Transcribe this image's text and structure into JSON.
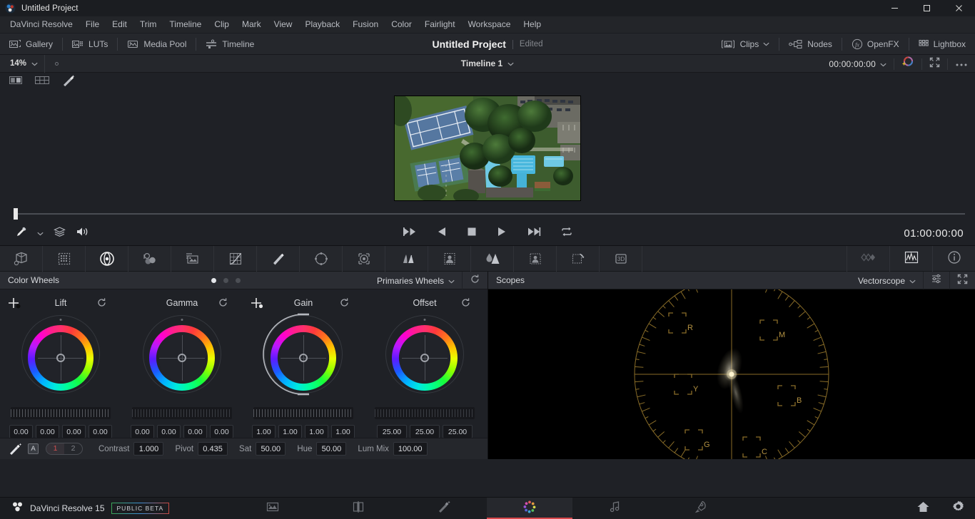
{
  "window": {
    "title": "Untitled Project",
    "logo_icon": "davinci-resolve-logo-icon",
    "minimize_icon": "minimize-icon",
    "maximize_icon": "maximize-icon",
    "close_icon": "close-icon"
  },
  "menubar": {
    "items": [
      "DaVinci Resolve",
      "File",
      "Edit",
      "Trim",
      "Timeline",
      "Clip",
      "Mark",
      "View",
      "Playback",
      "Fusion",
      "Color",
      "Fairlight",
      "Workspace",
      "Help"
    ]
  },
  "toolbar": {
    "left": [
      {
        "label": "Gallery",
        "icon": "gallery-icon"
      },
      {
        "label": "LUTs",
        "icon": "luts-icon"
      },
      {
        "label": "Media Pool",
        "icon": "media-pool-icon"
      },
      {
        "label": "Timeline",
        "icon": "timeline-icon"
      }
    ],
    "right": [
      {
        "label": "Clips",
        "icon": "clips-icon",
        "has_chevron": true
      },
      {
        "label": "Nodes",
        "icon": "nodes-icon",
        "has_chevron": false
      },
      {
        "label": "OpenFX",
        "icon": "openfx-icon",
        "has_chevron": false
      },
      {
        "label": "Lightbox",
        "icon": "lightbox-icon",
        "has_chevron": false
      }
    ],
    "project_name": "Untitled Project",
    "project_status": "Edited"
  },
  "viewer_header": {
    "zoom": "14%",
    "zoom_chevron_icon": "chevron-down-icon",
    "fit_dot_icon": "fit-dot-icon",
    "timeline_name": "Timeline 1",
    "timeline_chevron_icon": "chevron-down-icon",
    "timecode": "00:00:00:00",
    "timecode_chevron_icon": "chevron-down-icon",
    "color_wheel_icon": "enhanced-viewer-icon",
    "fullscreen_icon": "fullscreen-icon",
    "more_options_icon": "more-options-icon"
  },
  "viewer_modes": [
    {
      "icon": "split-screen-icon"
    },
    {
      "icon": "grid-view-icon"
    },
    {
      "icon": "magic-wand-icon"
    }
  ],
  "viewer": {
    "image_description": "aerial-drone-view-of-tennis-courts-and-swimming-pools"
  },
  "transport": {
    "eyedropper_icon": "eyedropper-icon",
    "eyedropper_chevron_icon": "chevron-down-icon",
    "layers_icon": "layers-icon",
    "audio_icon": "speaker-icon",
    "controls": [
      {
        "icon": "skip-to-start-icon"
      },
      {
        "icon": "play-reverse-icon"
      },
      {
        "icon": "stop-icon"
      },
      {
        "icon": "play-forward-icon"
      },
      {
        "icon": "skip-to-end-icon"
      },
      {
        "icon": "loop-icon"
      }
    ],
    "timecode": "01:00:00:00"
  },
  "palette_bar": {
    "icons": [
      "camera-raw-icon",
      "color-match-icon",
      "color-wheels-icon",
      "color-bars-icon",
      "log-wheels-icon",
      "curves-icon",
      "color-warper-icon",
      "qualifier-icon",
      "power-windows-icon",
      "tracker-icon",
      "magic-mask-icon",
      "blur-icon",
      "key-icon",
      "sizing-icon",
      "stabilizer-icon",
      "3d-icon"
    ],
    "active_index": 2,
    "right_icons": [
      "keyframes-icon",
      "scopes-icon",
      "info-icon"
    ]
  },
  "color_wheels_panel": {
    "title": "Color Wheels",
    "mode": "Primaries Wheels",
    "mode_chevron_icon": "chevron-down-icon",
    "reset_icon": "reset-icon",
    "page_dots": {
      "count": 3,
      "active": 0
    },
    "wheels": [
      {
        "name": "Lift",
        "reset_icon": "reset-icon",
        "values": [
          "0.00",
          "0.00",
          "0.00",
          "0.00"
        ],
        "master_arc": false,
        "has_cross_handle": true,
        "slider_dim": false
      },
      {
        "name": "Gamma",
        "reset_icon": "reset-icon",
        "values": [
          "0.00",
          "0.00",
          "0.00",
          "0.00"
        ],
        "master_arc": false,
        "has_cross_handle": false,
        "slider_dim": true
      },
      {
        "name": "Gain",
        "reset_icon": "reset-icon",
        "values": [
          "1.00",
          "1.00",
          "1.00",
          "1.00"
        ],
        "master_arc": true,
        "has_cross_handle": true,
        "slider_dim": false
      },
      {
        "name": "Offset",
        "reset_icon": "reset-icon",
        "values": [
          "25.00",
          "25.00",
          "25.00"
        ],
        "master_arc": false,
        "has_cross_handle": false,
        "slider_dim": true
      }
    ]
  },
  "param_bar": {
    "magic_icon": "auto-balance-icon",
    "a_badge": "A",
    "nodes": [
      "1",
      "2"
    ],
    "params": [
      {
        "label": "Contrast",
        "value": "1.000"
      },
      {
        "label": "Pivot",
        "value": "0.435"
      },
      {
        "label": "Sat",
        "value": "50.00"
      },
      {
        "label": "Hue",
        "value": "50.00"
      },
      {
        "label": "Lum Mix",
        "value": "100.00"
      }
    ]
  },
  "scopes_panel": {
    "title": "Scopes",
    "scope_type": "Vectorscope",
    "scope_chevron_icon": "chevron-down-icon",
    "settings_icon": "scope-settings-icon",
    "expand_icon": "fullscreen-icon",
    "targets": [
      "R",
      "M",
      "Y",
      "B",
      "G",
      "C"
    ]
  },
  "status_bar": {
    "app_icon": "davinci-logo-icon",
    "app_name": "DaVinci Resolve 15",
    "badge": "PUBLIC BETA",
    "pages": [
      {
        "name": "media",
        "icon": "media-page-icon",
        "active": false
      },
      {
        "name": "edit",
        "icon": "edit-page-icon",
        "active": false
      },
      {
        "name": "fusion",
        "icon": "fusion-page-icon",
        "active": false
      },
      {
        "name": "color",
        "icon": "color-page-icon",
        "active": true
      },
      {
        "name": "fairlight",
        "icon": "fairlight-page-icon",
        "active": false
      },
      {
        "name": "deliver",
        "icon": "deliver-page-icon",
        "active": false
      }
    ],
    "right_icons": [
      "home-icon",
      "settings-gear-icon"
    ]
  }
}
